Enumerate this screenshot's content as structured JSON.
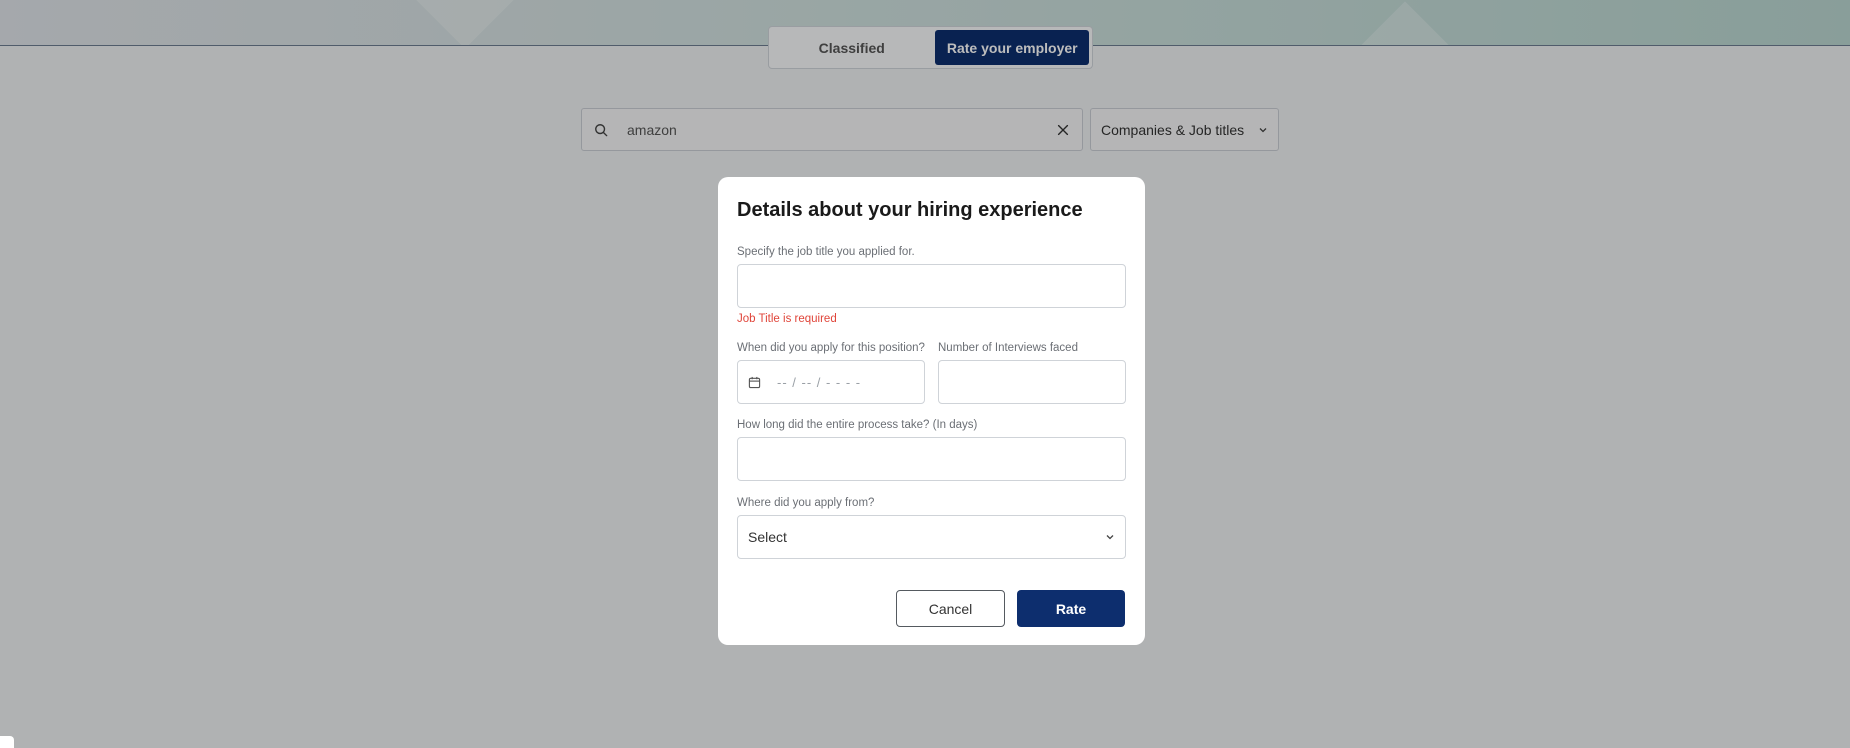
{
  "tabs": {
    "classified": "Classified",
    "rate_employer": "Rate your employer"
  },
  "search": {
    "value": "amazon",
    "search_icon": "search-icon",
    "clear_icon": "close-icon"
  },
  "category_select": {
    "selected": "Companies & Job titles",
    "icon": "chevron-down-icon"
  },
  "modal": {
    "title": "Details about your hiring experience",
    "job_title_label": "Specify the job title you applied for.",
    "job_title_error": "Job Title is required",
    "apply_date_label": "When did you apply for this position?",
    "apply_date_placeholder": "-- / -- / - - - -",
    "apply_date_icon": "calendar-icon",
    "interviews_label": "Number of Interviews faced",
    "process_length_label": "How long did the entire process take? (In days)",
    "apply_from_label": "Where did you apply from?",
    "apply_from_selected": "Select",
    "apply_from_icon": "chevron-down-icon",
    "cancel_label": "Cancel",
    "rate_label": "Rate"
  },
  "colors": {
    "primary": "#0d2e6e",
    "error": "#e0453a"
  }
}
